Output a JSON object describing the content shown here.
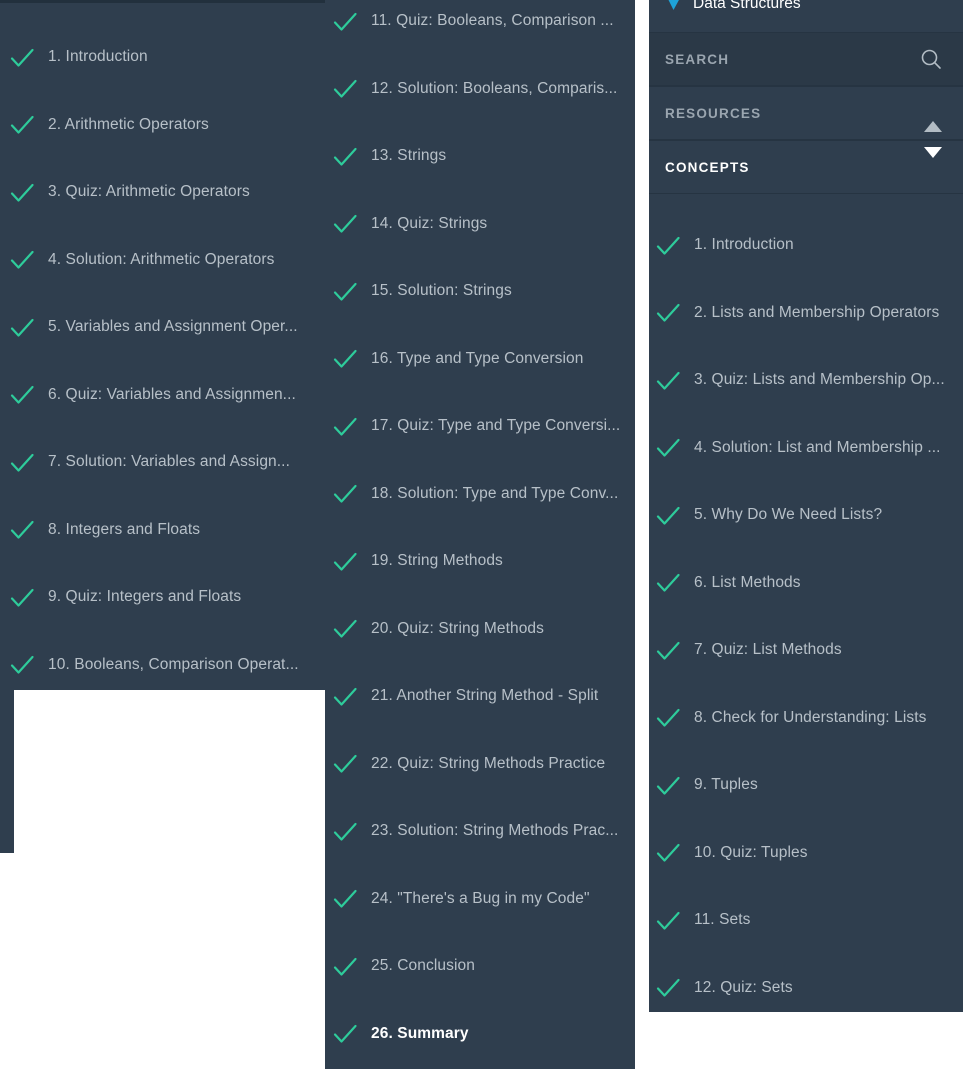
{
  "colors": {
    "panel_bg": "#2f3e4e",
    "panel_bg_alt": "#2b3947",
    "divider": "#263442",
    "check_green": "#2ecc9b",
    "label_text": "#b7c0c8",
    "active_text": "#ffffff",
    "muted_header_text": "#9aa5af",
    "back_arrow_blue": "#1ea3d8",
    "page_bg": "#ffffff"
  },
  "lesson_panel_left": {
    "items": [
      {
        "label": "1. Introduction",
        "status": "complete",
        "current": false
      },
      {
        "label": "2. Arithmetic Operators",
        "status": "complete",
        "current": false
      },
      {
        "label": "3. Quiz: Arithmetic Operators",
        "status": "complete",
        "current": false
      },
      {
        "label": "4. Solution: Arithmetic Operators",
        "status": "complete",
        "current": false
      },
      {
        "label": "5. Variables and Assignment Oper...",
        "status": "complete",
        "current": false
      },
      {
        "label": "6. Quiz: Variables and Assignmen...",
        "status": "complete",
        "current": false
      },
      {
        "label": "7. Solution: Variables and Assign...",
        "status": "complete",
        "current": false
      },
      {
        "label": "8. Integers and Floats",
        "status": "complete",
        "current": false
      },
      {
        "label": "9. Quiz: Integers and Floats",
        "status": "complete",
        "current": false
      },
      {
        "label": "10. Booleans, Comparison Operat...",
        "status": "complete",
        "current": false
      }
    ]
  },
  "lesson_panel_middle": {
    "items": [
      {
        "label": "11. Quiz: Booleans, Comparison ...",
        "status": "complete",
        "current": false
      },
      {
        "label": "12. Solution: Booleans, Comparis...",
        "status": "complete",
        "current": false
      },
      {
        "label": "13. Strings",
        "status": "complete",
        "current": false
      },
      {
        "label": "14. Quiz: Strings",
        "status": "complete",
        "current": false
      },
      {
        "label": "15. Solution: Strings",
        "status": "complete",
        "current": false
      },
      {
        "label": "16. Type and Type Conversion",
        "status": "complete",
        "current": false
      },
      {
        "label": "17. Quiz: Type and Type Conversi...",
        "status": "complete",
        "current": false
      },
      {
        "label": "18. Solution: Type and Type Conv...",
        "status": "complete",
        "current": false
      },
      {
        "label": "19. String Methods",
        "status": "complete",
        "current": false
      },
      {
        "label": "20. Quiz: String Methods",
        "status": "complete",
        "current": false
      },
      {
        "label": "21. Another String Method - Split",
        "status": "complete",
        "current": false
      },
      {
        "label": "22. Quiz: String Methods Practice",
        "status": "complete",
        "current": false
      },
      {
        "label": "23. Solution: String Methods Prac...",
        "status": "complete",
        "current": false
      },
      {
        "label": "24. \"There's a Bug in my Code\"",
        "status": "complete",
        "current": false
      },
      {
        "label": "25. Conclusion",
        "status": "complete",
        "current": false
      },
      {
        "label": "26. Summary",
        "status": "complete",
        "current": true
      }
    ]
  },
  "course_panel_right": {
    "header": {
      "back_icon": "back-arrow-icon",
      "title": "Data Structures"
    },
    "nav": {
      "search": {
        "label": "SEARCH",
        "icon": "search-icon"
      },
      "resources": {
        "label": "RESOURCES",
        "icon": "triangle-up-icon",
        "expanded": false
      },
      "concepts": {
        "label": "CONCEPTS",
        "icon": "triangle-down-icon",
        "expanded": true
      }
    },
    "items": [
      {
        "label": "1. Introduction",
        "status": "complete",
        "current": false
      },
      {
        "label": "2. Lists and Membership Operators",
        "status": "complete",
        "current": false
      },
      {
        "label": "3. Quiz: Lists and Membership Op...",
        "status": "complete",
        "current": false
      },
      {
        "label": "4. Solution: List and Membership ...",
        "status": "complete",
        "current": false
      },
      {
        "label": "5. Why Do We Need Lists?",
        "status": "complete",
        "current": false
      },
      {
        "label": "6. List Methods",
        "status": "complete",
        "current": false
      },
      {
        "label": "7. Quiz: List Methods",
        "status": "complete",
        "current": false
      },
      {
        "label": "8. Check for Understanding: Lists",
        "status": "complete",
        "current": false
      },
      {
        "label": "9. Tuples",
        "status": "complete",
        "current": false
      },
      {
        "label": "10. Quiz: Tuples",
        "status": "complete",
        "current": false
      },
      {
        "label": "11. Sets",
        "status": "complete",
        "current": false
      },
      {
        "label": "12. Quiz: Sets",
        "status": "complete",
        "current": false
      }
    ]
  }
}
